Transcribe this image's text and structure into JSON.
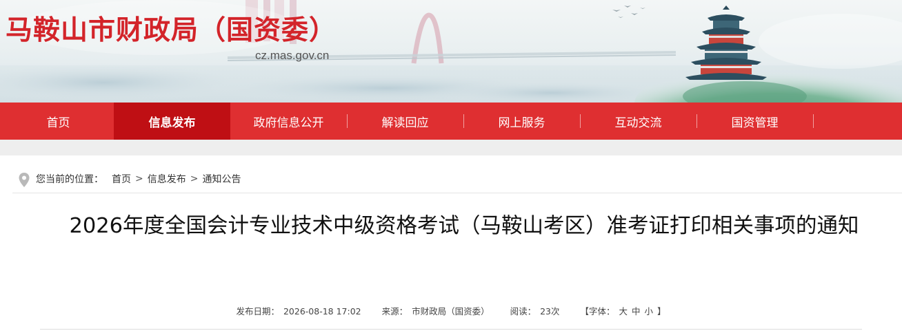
{
  "header": {
    "site_title": "马鞍山市财政局（国资委）",
    "site_domain": "cz.mas.gov.cn",
    "brand_color": "#d3242a"
  },
  "nav": {
    "items": [
      {
        "label": "首页",
        "active": false
      },
      {
        "label": "信息发布",
        "active": true
      },
      {
        "label": "政府信息公开",
        "active": false
      },
      {
        "label": "解读回应",
        "active": false
      },
      {
        "label": "网上服务",
        "active": false
      },
      {
        "label": "互动交流",
        "active": false
      },
      {
        "label": "国资管理",
        "active": false
      }
    ],
    "bar_color": "#df2f31",
    "active_color": "#bf0f14"
  },
  "breadcrumb": {
    "prefix": "您当前的位置：",
    "items": [
      "首页",
      "信息发布",
      "通知公告"
    ],
    "separator": ">"
  },
  "article": {
    "title": "2026年度全国会计专业技术中级资格考试（马鞍山考区）准考证打印相关事项的通知",
    "meta": {
      "date_label": "发布日期：",
      "date": "2026-08-18 17:02",
      "source_label": "来源：",
      "source": "市财政局（国资委）",
      "views_label": "阅读：",
      "views": "23次",
      "font_label": "【字体：",
      "font_sizes": [
        "大",
        "中",
        "小"
      ],
      "font_close": "】"
    }
  }
}
